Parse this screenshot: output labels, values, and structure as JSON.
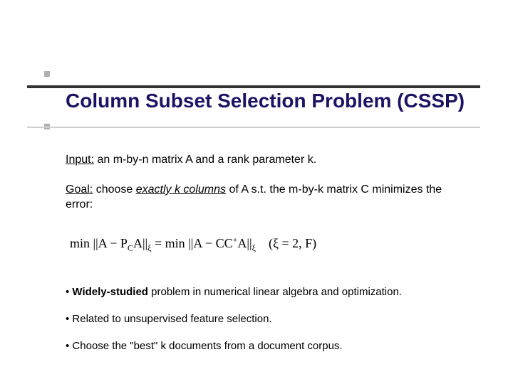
{
  "title": "Column Subset Selection Problem (CSSP)",
  "body": {
    "input": {
      "label": "Input:",
      "text": " an m-by-n matrix A and a rank parameter k."
    },
    "goal": {
      "label": "Goal:",
      "pre": " choose ",
      "emph": "exactly k columns",
      "post": " of A s.t. the m-by-k matrix C minimizes the error:"
    }
  },
  "formula": {
    "lhs_min": "min",
    "rhs_min": "min",
    "A": "A",
    "P": "P",
    "Csub": "C",
    "C": "C",
    "plus": "+",
    "xi": "ξ",
    "eq": " = ",
    "cond": "= 2, F"
  },
  "bullets": [
    {
      "bold": "Widely-studied",
      "rest": " problem in numerical linear algebra and optimization."
    },
    {
      "bold": "",
      "rest": "Related to unsupervised feature selection."
    },
    {
      "bold": "",
      "rest": "Choose the \"best\" k documents from a document corpus."
    }
  ]
}
